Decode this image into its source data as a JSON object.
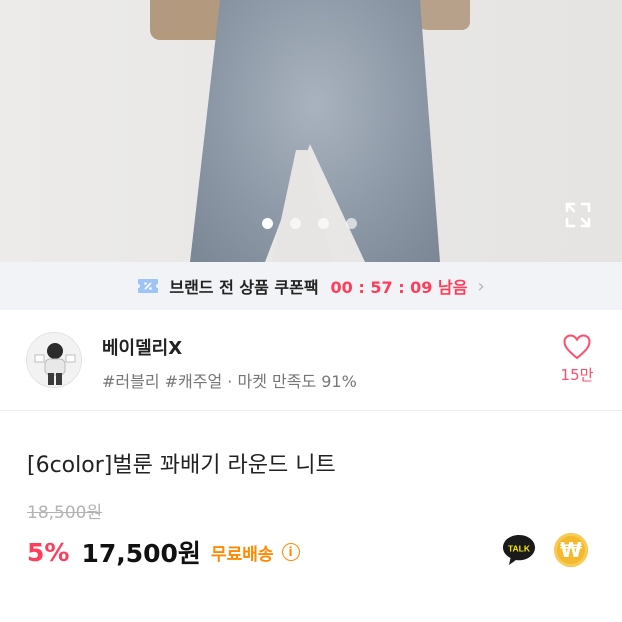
{
  "coupon_bar": {
    "icon": "percent-coupon-icon",
    "text": "브랜드 전 상품 쿠폰팩",
    "timer": "00 : 57 : 09 남음",
    "chevron": "›"
  },
  "carousel": {
    "slide_count": 4,
    "active_index": 0,
    "expand_icon": "expand-icon"
  },
  "seller": {
    "name": "베이델리X",
    "tags": "#러블리 #캐주얼 · 마켓 만족도 91%",
    "likes": "15만"
  },
  "product": {
    "title": "[6color]벌룬 꽈배기 라운드 니트",
    "original_price": "18,500원",
    "discount": "5%",
    "price": "17,500원",
    "shipping": "무료배송",
    "info_icon": "i"
  },
  "actions": {
    "talk_label": "TALK",
    "won_label": "₩"
  },
  "colors": {
    "accent_pink": "#ff3d5a",
    "shipping_orange": "#ff8a00",
    "kakao_black": "#1a1a1a",
    "coin_gold": "#f4b92c"
  }
}
